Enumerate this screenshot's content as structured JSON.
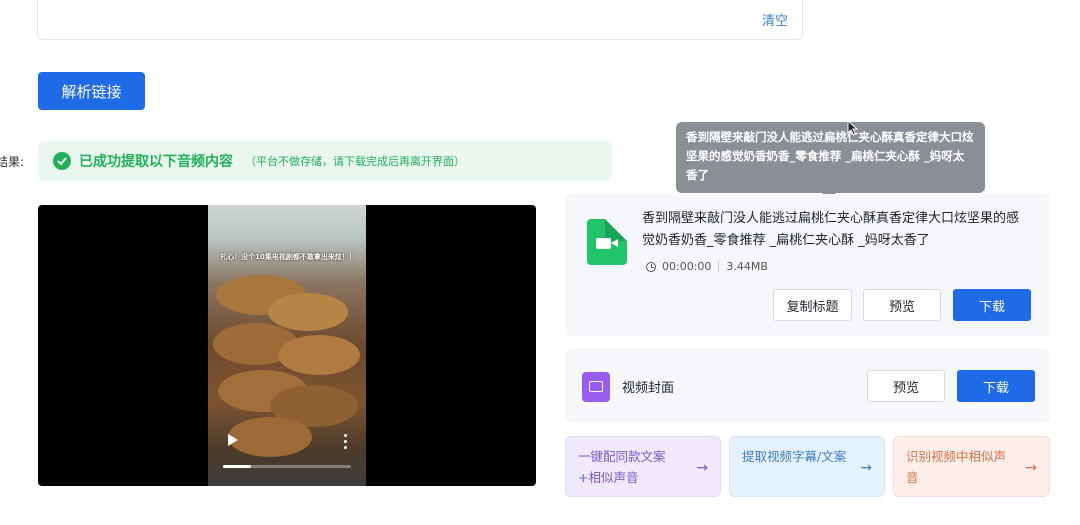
{
  "input": {
    "clear_label": "清空"
  },
  "actions": {
    "parse_label": "解析链接"
  },
  "result": {
    "label": "结果:",
    "success_text": "已成功提取以下音频内容",
    "success_note": "（平台不做存储，请下载完成后再离开界面）"
  },
  "player": {
    "frame_caption": "扎心！没个10集电视剧都不敢拿出来炫！！",
    "progress_fraction": 0.22
  },
  "tooltip": {
    "text": "香到隔壁来敲门没人能逃过扁桃仁夹心酥真香定律大口炫坚果的感觉奶香奶香_零食推荐 _扁桃仁夹心酥 _妈呀太香了"
  },
  "video_item": {
    "title": "香到隔壁来敲门没人能逃过扁桃仁夹心酥真香定律大口炫坚果的感觉奶香奶香_零食推荐 _扁桃仁夹心酥 _妈呀太香了",
    "duration": "00:00:00",
    "size": "3.44MB",
    "copy_title_label": "复制标题",
    "preview_label": "预览",
    "download_label": "下载"
  },
  "cover_item": {
    "label": "视频封面",
    "preview_label": "预览",
    "download_label": "下载"
  },
  "features": [
    {
      "text": "一键配同款文案+相似声音",
      "arrow": "→"
    },
    {
      "text": "提取视频字幕/文案",
      "arrow": "→"
    },
    {
      "text": "识别视频中相似声音",
      "arrow": "→"
    }
  ],
  "colors": {
    "primary": "#1f6ae6",
    "success": "#22b05a",
    "video_icon": "#22c46a",
    "image_icon": "#9a5cf0"
  },
  "icons": [
    "check-circle-icon",
    "video-file-icon",
    "clock-icon",
    "image-icon",
    "play-icon",
    "more-icon",
    "arrow-right-icon",
    "cursor-icon"
  ]
}
